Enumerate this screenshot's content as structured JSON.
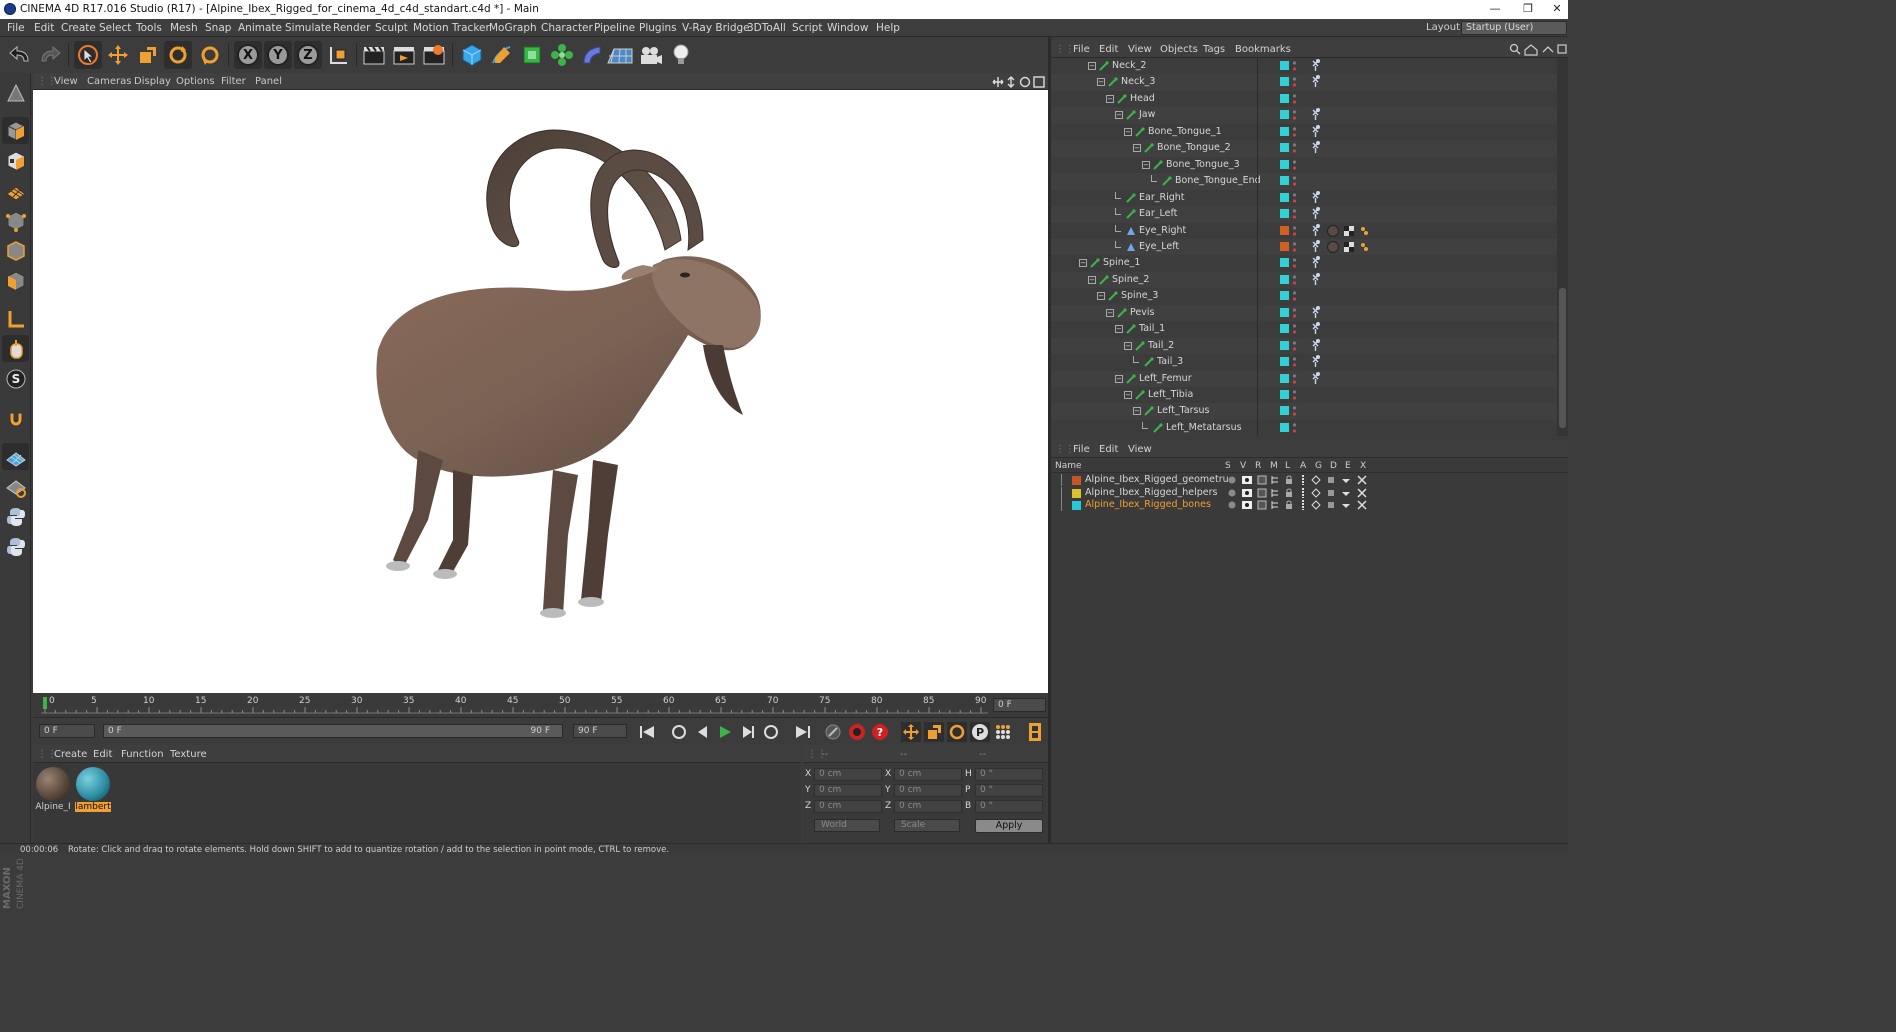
{
  "window": {
    "title": "CINEMA 4D R17.016 Studio (R17) - [Alpine_Ibex_Rigged_for_cinema_4d_c4d_standart.c4d *] - Main",
    "minimize": "—",
    "restore": "❐",
    "close": "✕"
  },
  "menubar": {
    "items": [
      "File",
      "Edit",
      "Create",
      "Select",
      "Tools",
      "Mesh",
      "Snap",
      "Animate",
      "Simulate",
      "Render",
      "Sculpt",
      "Motion Tracker",
      "MoGraph",
      "Character",
      "Pipeline",
      "Plugins",
      "V-Ray Bridge",
      "3DToAll",
      "Script",
      "Window",
      "Help"
    ],
    "layout_label": "Layout:",
    "layout_value": "Startup (User)"
  },
  "toolbar": {
    "axis_labels": [
      "X",
      "Y",
      "Z"
    ]
  },
  "viewport": {
    "menu": [
      "View",
      "Cameras",
      "Display",
      "Options",
      "Filter",
      "Panel"
    ]
  },
  "timeline": {
    "ticks": [
      "0",
      "5",
      "10",
      "15",
      "20",
      "25",
      "30",
      "35",
      "40",
      "45",
      "50",
      "55",
      "60",
      "65",
      "70",
      "75",
      "80",
      "85",
      "90"
    ],
    "current_frame": "0 F"
  },
  "transport": {
    "start_field": "0 F",
    "range_start": "0 F",
    "range_end": "90 F",
    "end_field": "90 F"
  },
  "materials": {
    "menu": [
      "Create",
      "Edit",
      "Function",
      "Texture"
    ],
    "items": [
      {
        "label": "Alpine_I",
        "selected": false
      },
      {
        "label": "lambert",
        "selected": true
      }
    ]
  },
  "coordinates": {
    "header_left": "--",
    "header_mid": "--",
    "header_right": "--",
    "rows": [
      {
        "a": "X",
        "a_val": "0 cm",
        "b": "X",
        "b_val": "0 cm",
        "c": "H",
        "c_val": "0 °"
      },
      {
        "a": "Y",
        "a_val": "0 cm",
        "b": "Y",
        "b_val": "0 cm",
        "c": "P",
        "c_val": "0 °"
      },
      {
        "a": "Z",
        "a_val": "0 cm",
        "b": "Z",
        "b_val": "0 cm",
        "c": "B",
        "c_val": "0 °"
      }
    ],
    "space_select": "World",
    "mode_select": "Scale",
    "apply": "Apply"
  },
  "status": {
    "time": "00:00:06",
    "message": "Rotate: Click and drag to rotate elements. Hold down SHIFT to add to quantize rotation / add to the selection in point mode, CTRL to remove."
  },
  "object_manager": {
    "menu": [
      "File",
      "Edit",
      "View",
      "Objects",
      "Tags",
      "Bookmarks"
    ],
    "rows": [
      {
        "name": "Neck_2",
        "depth": 5,
        "exp": "minus",
        "color": "cyan",
        "tags": 1
      },
      {
        "name": "Neck_3",
        "depth": 6,
        "exp": "minus",
        "color": "cyan",
        "tags": 1
      },
      {
        "name": "Head",
        "depth": 7,
        "exp": "minus",
        "color": "cyan",
        "tags": 0
      },
      {
        "name": "Jaw",
        "depth": 8,
        "exp": "minus",
        "color": "cyan",
        "tags": 1
      },
      {
        "name": "Bone_Tongue_1",
        "depth": 9,
        "exp": "minus",
        "color": "cyan",
        "tags": 1
      },
      {
        "name": "Bone_Tongue_2",
        "depth": 10,
        "exp": "minus",
        "color": "cyan",
        "tags": 1
      },
      {
        "name": "Bone_Tongue_3",
        "depth": 11,
        "exp": "minus",
        "color": "cyan",
        "tags": 0
      },
      {
        "name": "Bone_Tongue_End",
        "depth": 12,
        "exp": "end",
        "color": "cyan",
        "tags": 0
      },
      {
        "name": "Ear_Right",
        "depth": 8,
        "exp": "end",
        "color": "cyan",
        "tags": 1
      },
      {
        "name": "Ear_Left",
        "depth": 8,
        "exp": "end",
        "color": "cyan",
        "tags": 1
      },
      {
        "name": "Eye_Right",
        "depth": 8,
        "exp": "end",
        "color": "orange",
        "tags": 2
      },
      {
        "name": "Eye_Left",
        "depth": 8,
        "exp": "end",
        "color": "orange",
        "tags": 2
      },
      {
        "name": "Spine_1",
        "depth": 4,
        "exp": "minus",
        "color": "cyan",
        "tags": 1
      },
      {
        "name": "Spine_2",
        "depth": 5,
        "exp": "minus",
        "color": "cyan",
        "tags": 1
      },
      {
        "name": "Spine_3",
        "depth": 6,
        "exp": "minus",
        "color": "cyan",
        "tags": 0
      },
      {
        "name": "Pevis",
        "depth": 7,
        "exp": "minus",
        "color": "cyan",
        "tags": 1
      },
      {
        "name": "Tail_1",
        "depth": 8,
        "exp": "minus",
        "color": "cyan",
        "tags": 1
      },
      {
        "name": "Tail_2",
        "depth": 9,
        "exp": "minus",
        "color": "cyan",
        "tags": 1
      },
      {
        "name": "Tail_3",
        "depth": 10,
        "exp": "end",
        "color": "cyan",
        "tags": 1
      },
      {
        "name": "Left_Femur",
        "depth": 8,
        "exp": "minus",
        "color": "cyan",
        "tags": 1
      },
      {
        "name": "Left_Tibia",
        "depth": 9,
        "exp": "minus",
        "color": "cyan",
        "tags": 0
      },
      {
        "name": "Left_Tarsus",
        "depth": 10,
        "exp": "minus",
        "color": "cyan",
        "tags": 0
      },
      {
        "name": "Left_Metatarsus",
        "depth": 11,
        "exp": "end",
        "color": "cyan",
        "tags": 0
      }
    ]
  },
  "layer_manager": {
    "menu": [
      "File",
      "Edit",
      "View"
    ],
    "columns": [
      "Name",
      "S",
      "V",
      "R",
      "M",
      "L",
      "A",
      "G",
      "D",
      "E",
      "X"
    ],
    "layers": [
      {
        "name": "Alpine_Ibex_Rigged_geometru",
        "color": "#c8542a",
        "active": false
      },
      {
        "name": "Alpine_Ibex_Rigged_helpers",
        "color": "#d8c42a",
        "active": false
      },
      {
        "name": "Alpine_Ibex_Rigged_bones",
        "color": "#28c8d8",
        "active": true
      }
    ]
  },
  "colors": {
    "accent_orange": "#f0a030",
    "layer_cyan": "#33d0d8",
    "layer_orange": "#d06020",
    "bone_green": "#3cb44a"
  }
}
